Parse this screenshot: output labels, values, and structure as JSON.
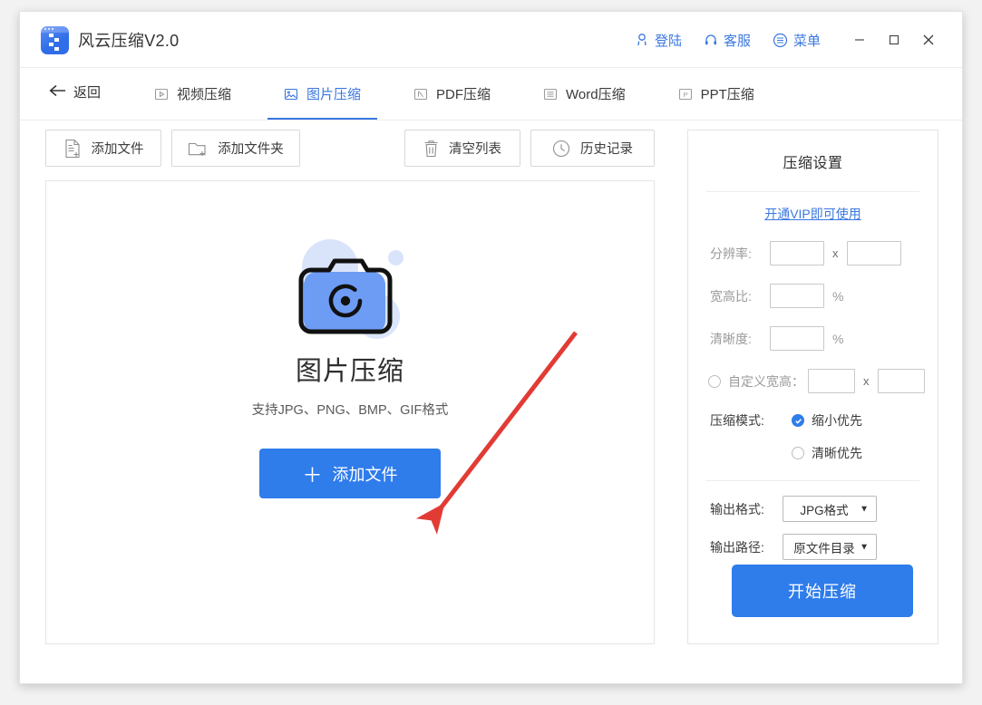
{
  "window": {
    "title": "风云压缩V2.0",
    "app_icon": "zip-app-icon",
    "accent_color": "#2f7ceb",
    "link_color": "#3b77e0"
  },
  "titlebar": {
    "actions": [
      {
        "label": "登陆",
        "icon": "user-icon"
      },
      {
        "label": "客服",
        "icon": "headset-icon"
      },
      {
        "label": "菜单",
        "icon": "menu-list-icon"
      }
    ],
    "minimize": "−",
    "maximize": "□",
    "close": "✕"
  },
  "nav": {
    "back_label": "返回",
    "back_icon": "arrow-left-icon",
    "tabs": [
      {
        "label": "视频压缩",
        "icon": "video-icon",
        "active": false
      },
      {
        "label": "图片压缩",
        "icon": "image-icon",
        "active": true
      },
      {
        "label": "PDF压缩",
        "icon": "pdf-icon",
        "active": false
      },
      {
        "label": "Word压缩",
        "icon": "word-icon",
        "active": false
      },
      {
        "label": "PPT压缩",
        "icon": "ppt-icon",
        "active": false
      }
    ]
  },
  "toolbar": {
    "add_file": "添加文件",
    "add_folder": "添加文件夹",
    "clear_list": "清空列表",
    "history": "历史记录"
  },
  "dropzone": {
    "title": "图片压缩",
    "subtitle": "支持JPG、PNG、BMP、GIF格式",
    "button_plus": "＋",
    "button_label": "添加文件",
    "illustration": "camera-icon"
  },
  "annotation": {
    "type": "red-arrow",
    "color": "#e23b35",
    "from": [
      635,
      367
    ],
    "to": [
      478,
      570
    ]
  },
  "settings": {
    "title": "压缩设置",
    "vip_link": "开通VIP即可使用",
    "resolution": {
      "label": "分辨率:",
      "width": "",
      "height": "",
      "separator": "x"
    },
    "aspect_ratio": {
      "label": "宽高比:",
      "value": "",
      "unit": "%"
    },
    "clarity": {
      "label": "清晰度:",
      "value": "",
      "unit": "%"
    },
    "custom_size": {
      "label": "自定义宽高：",
      "checked": false,
      "width": "",
      "height": "",
      "separator": "x"
    },
    "compress_mode": {
      "label": "压缩模式:",
      "options": [
        {
          "label": "缩小优先",
          "checked": true
        },
        {
          "label": "清晰优先",
          "checked": false
        }
      ]
    },
    "output_format": {
      "label": "输出格式:",
      "value": "JPG格式",
      "caret": "▼"
    },
    "output_path": {
      "label": "输出路径:",
      "value": "原文件目录",
      "caret": "▼"
    },
    "start_button": "开始压缩"
  }
}
